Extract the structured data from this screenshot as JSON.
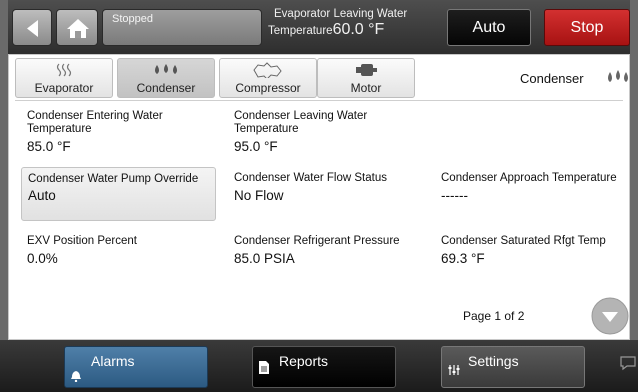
{
  "header": {
    "status_text": "Stopped",
    "readout_label_line1": "Evaporator Leaving Water",
    "readout_label_line2": "Temperature",
    "readout_value": "60.0 °F",
    "auto_label": "Auto",
    "stop_label": "Stop",
    "stop_color": "#c62020"
  },
  "tabs": [
    {
      "label": "Evaporator",
      "icon": "heat-waves-icon"
    },
    {
      "label": "Condenser",
      "icon": "water-drops-icon"
    },
    {
      "label": "Compressor",
      "icon": "compressor-icon"
    },
    {
      "label": "Motor",
      "icon": "motor-icon"
    }
  ],
  "active_tab": "Condenser",
  "section_title": "Condenser",
  "fields": {
    "entering_water": {
      "label_l1": "Condenser Entering Water",
      "label_l2": "Temperature",
      "value": "85.0 °F"
    },
    "leaving_water": {
      "label_l1": "Condenser Leaving Water",
      "label_l2": "Temperature",
      "value": "95.0 °F"
    },
    "pump_override": {
      "label": "Condenser Water Pump Override",
      "value": "Auto"
    },
    "flow_status": {
      "label": "Condenser Water Flow Status",
      "value": "No Flow"
    },
    "approach_temp": {
      "label": "Condenser Approach Temperature",
      "value": "------"
    },
    "exv_position": {
      "label": "EXV Position Percent",
      "value": "0.0%"
    },
    "refrigerant_pressure": {
      "label": "Condenser Refrigerant Pressure",
      "value": "85.0 PSIA"
    },
    "saturated_temp": {
      "label": "Condenser Saturated Rfgt Temp",
      "value": "69.3 °F"
    }
  },
  "pagination": {
    "text": "Page 1 of 2"
  },
  "bottom_nav": {
    "alarms": "Alarms",
    "reports": "Reports",
    "settings": "Settings"
  }
}
